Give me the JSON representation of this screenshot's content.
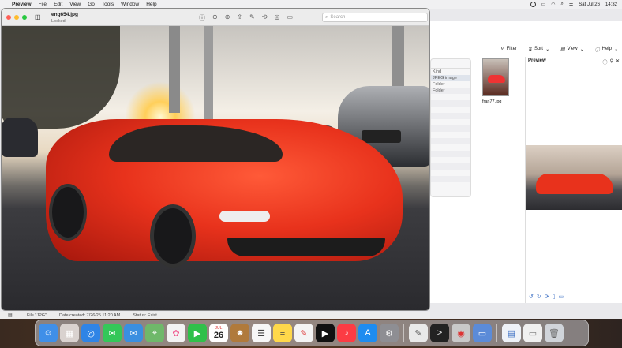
{
  "menubar": {
    "apple_glyph": "",
    "app_name": "Preview",
    "menus": [
      "File",
      "Edit",
      "View",
      "Go",
      "Tools",
      "Window",
      "Help"
    ],
    "datetime": "Sat Jul 26",
    "time": "14:32"
  },
  "preview_window": {
    "title": "eng654.jpg",
    "subtitle": "Locked",
    "search_placeholder": "Search",
    "status": {
      "file": "File \"JPG\"",
      "date_created": "Date created: 7/26/25 11:20 AM",
      "status": "Status: Exist"
    }
  },
  "file_manager": {
    "toolbar": {
      "filter": "Filter",
      "sort": "Sort",
      "view": "View",
      "help": "Help"
    },
    "list": {
      "column_header": "Kind",
      "rows": [
        "JPEG image",
        "Folder",
        "Folder"
      ]
    },
    "thumbnail_label": "fran77.jpg",
    "preview_title": "Preview"
  },
  "dock": {
    "calendar_month": "JUL",
    "calendar_day": "26"
  },
  "colors": {
    "accent": "#3b6fc4",
    "close": "#ff5f57",
    "minimize": "#febc2e",
    "zoom": "#28c840"
  }
}
